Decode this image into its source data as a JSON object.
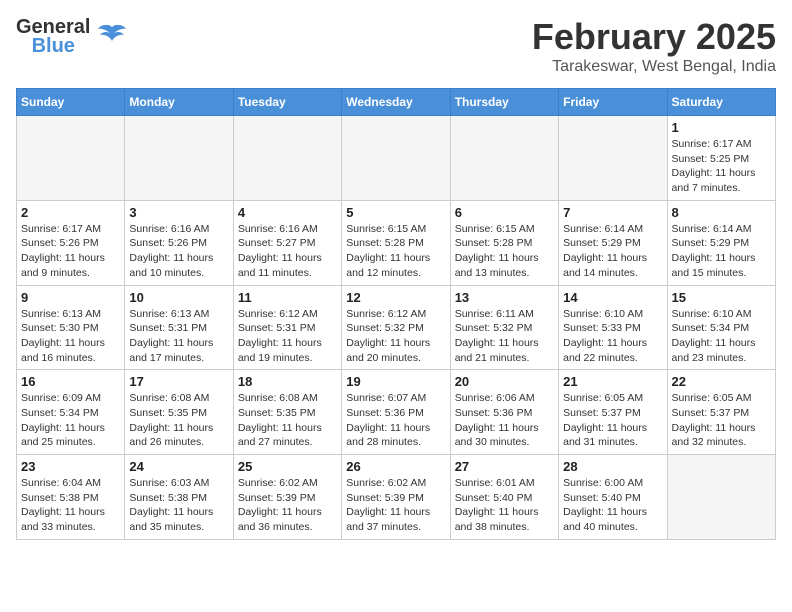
{
  "header": {
    "logo_line1": "General",
    "logo_line2": "Blue",
    "month": "February 2025",
    "location": "Tarakeswar, West Bengal, India"
  },
  "weekdays": [
    "Sunday",
    "Monday",
    "Tuesday",
    "Wednesday",
    "Thursday",
    "Friday",
    "Saturday"
  ],
  "weeks": [
    [
      {
        "day": "",
        "info": ""
      },
      {
        "day": "",
        "info": ""
      },
      {
        "day": "",
        "info": ""
      },
      {
        "day": "",
        "info": ""
      },
      {
        "day": "",
        "info": ""
      },
      {
        "day": "",
        "info": ""
      },
      {
        "day": "1",
        "info": "Sunrise: 6:17 AM\nSunset: 5:25 PM\nDaylight: 11 hours\nand 7 minutes."
      }
    ],
    [
      {
        "day": "2",
        "info": "Sunrise: 6:17 AM\nSunset: 5:26 PM\nDaylight: 11 hours\nand 9 minutes."
      },
      {
        "day": "3",
        "info": "Sunrise: 6:16 AM\nSunset: 5:26 PM\nDaylight: 11 hours\nand 10 minutes."
      },
      {
        "day": "4",
        "info": "Sunrise: 6:16 AM\nSunset: 5:27 PM\nDaylight: 11 hours\nand 11 minutes."
      },
      {
        "day": "5",
        "info": "Sunrise: 6:15 AM\nSunset: 5:28 PM\nDaylight: 11 hours\nand 12 minutes."
      },
      {
        "day": "6",
        "info": "Sunrise: 6:15 AM\nSunset: 5:28 PM\nDaylight: 11 hours\nand 13 minutes."
      },
      {
        "day": "7",
        "info": "Sunrise: 6:14 AM\nSunset: 5:29 PM\nDaylight: 11 hours\nand 14 minutes."
      },
      {
        "day": "8",
        "info": "Sunrise: 6:14 AM\nSunset: 5:29 PM\nDaylight: 11 hours\nand 15 minutes."
      }
    ],
    [
      {
        "day": "9",
        "info": "Sunrise: 6:13 AM\nSunset: 5:30 PM\nDaylight: 11 hours\nand 16 minutes."
      },
      {
        "day": "10",
        "info": "Sunrise: 6:13 AM\nSunset: 5:31 PM\nDaylight: 11 hours\nand 17 minutes."
      },
      {
        "day": "11",
        "info": "Sunrise: 6:12 AM\nSunset: 5:31 PM\nDaylight: 11 hours\nand 19 minutes."
      },
      {
        "day": "12",
        "info": "Sunrise: 6:12 AM\nSunset: 5:32 PM\nDaylight: 11 hours\nand 20 minutes."
      },
      {
        "day": "13",
        "info": "Sunrise: 6:11 AM\nSunset: 5:32 PM\nDaylight: 11 hours\nand 21 minutes."
      },
      {
        "day": "14",
        "info": "Sunrise: 6:10 AM\nSunset: 5:33 PM\nDaylight: 11 hours\nand 22 minutes."
      },
      {
        "day": "15",
        "info": "Sunrise: 6:10 AM\nSunset: 5:34 PM\nDaylight: 11 hours\nand 23 minutes."
      }
    ],
    [
      {
        "day": "16",
        "info": "Sunrise: 6:09 AM\nSunset: 5:34 PM\nDaylight: 11 hours\nand 25 minutes."
      },
      {
        "day": "17",
        "info": "Sunrise: 6:08 AM\nSunset: 5:35 PM\nDaylight: 11 hours\nand 26 minutes."
      },
      {
        "day": "18",
        "info": "Sunrise: 6:08 AM\nSunset: 5:35 PM\nDaylight: 11 hours\nand 27 minutes."
      },
      {
        "day": "19",
        "info": "Sunrise: 6:07 AM\nSunset: 5:36 PM\nDaylight: 11 hours\nand 28 minutes."
      },
      {
        "day": "20",
        "info": "Sunrise: 6:06 AM\nSunset: 5:36 PM\nDaylight: 11 hours\nand 30 minutes."
      },
      {
        "day": "21",
        "info": "Sunrise: 6:05 AM\nSunset: 5:37 PM\nDaylight: 11 hours\nand 31 minutes."
      },
      {
        "day": "22",
        "info": "Sunrise: 6:05 AM\nSunset: 5:37 PM\nDaylight: 11 hours\nand 32 minutes."
      }
    ],
    [
      {
        "day": "23",
        "info": "Sunrise: 6:04 AM\nSunset: 5:38 PM\nDaylight: 11 hours\nand 33 minutes."
      },
      {
        "day": "24",
        "info": "Sunrise: 6:03 AM\nSunset: 5:38 PM\nDaylight: 11 hours\nand 35 minutes."
      },
      {
        "day": "25",
        "info": "Sunrise: 6:02 AM\nSunset: 5:39 PM\nDaylight: 11 hours\nand 36 minutes."
      },
      {
        "day": "26",
        "info": "Sunrise: 6:02 AM\nSunset: 5:39 PM\nDaylight: 11 hours\nand 37 minutes."
      },
      {
        "day": "27",
        "info": "Sunrise: 6:01 AM\nSunset: 5:40 PM\nDaylight: 11 hours\nand 38 minutes."
      },
      {
        "day": "28",
        "info": "Sunrise: 6:00 AM\nSunset: 5:40 PM\nDaylight: 11 hours\nand 40 minutes."
      },
      {
        "day": "",
        "info": ""
      }
    ]
  ]
}
